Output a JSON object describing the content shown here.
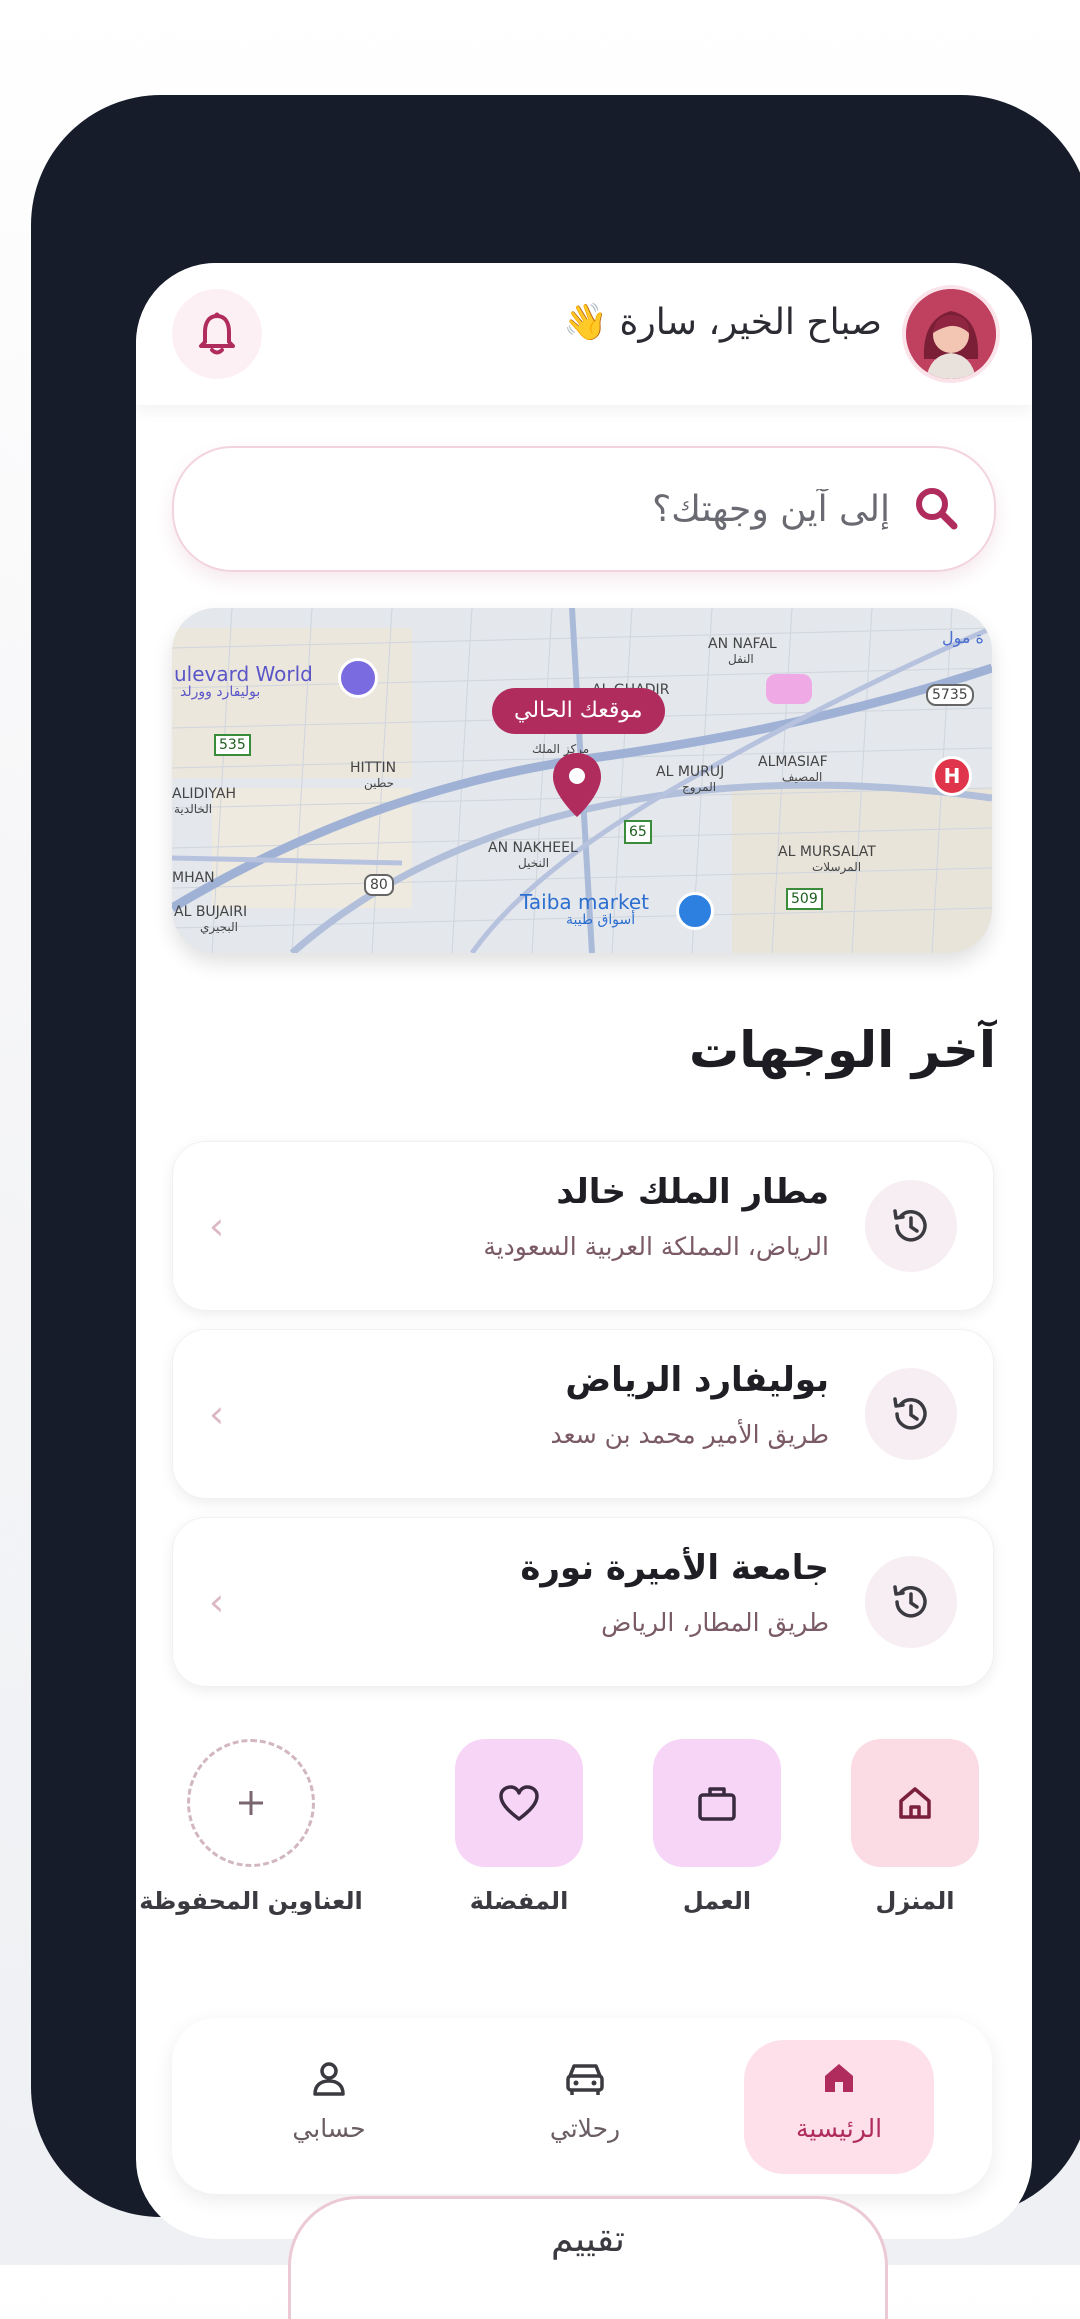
{
  "header": {
    "greeting": "صباح الخير، سارة 👋",
    "avatar": "avatar",
    "bell": "bell-icon"
  },
  "search": {
    "placeholder": "إلى آين وجهتك؟",
    "icon": "search-icon"
  },
  "map": {
    "current_location_label": "موقعك الحالي",
    "labels": {
      "boulevard": "ulevard World",
      "boulevard_ar": "بوليفارد وورلد",
      "an_nafal": "AN NAFAL",
      "an_nafal_ar": "النفل",
      "al_ghadir": "AL GHADIR",
      "hittin": "HITTIN",
      "hittin_ar": "حطين",
      "al_muruj": "AL MURUJ",
      "al_muruj_ar": "المروج",
      "al_masiaf": "ALMASIAF",
      "al_masiaf_ar": "المصيف",
      "alidiyah": "ALIDIYAH",
      "alidiyah_ar": "الخالدية",
      "an_nakheel": "AN NAKHEEL",
      "an_nakheel_ar": "النخيل",
      "al_mursalat": "AL MURSALAT",
      "al_mursalat_ar": "المرسلات",
      "mhan": "MHAN",
      "al_bujairi": "AL BUJAIRI",
      "al_bujairi_ar": "البجيري",
      "taiba_market": "Taiba market",
      "taiba_market_ar": "أسواق طيبة",
      "center_ar": "مركز الملك",
      "mall_ar": "ة مول",
      "road_535": "535",
      "road_5735": "5735",
      "road_65": "65",
      "road_80": "80",
      "road_509": "509",
      "hospital": "H"
    }
  },
  "recent": {
    "title": "آخر الوجهات",
    "items": [
      {
        "name": "مطار الملك خالد",
        "address": "الرياض، المملكة العربية السعودية"
      },
      {
        "name": "بوليفارد الرياض",
        "address": "طريق الأمير محمد بن سعد"
      },
      {
        "name": "جامعة الأميرة نورة",
        "address": "طريق المطار، الرياض"
      }
    ]
  },
  "quick_actions": [
    {
      "label": "المنزل",
      "icon": "home-icon"
    },
    {
      "label": "العمل",
      "icon": "briefcase-icon"
    },
    {
      "label": "المفضلة",
      "icon": "heart-icon"
    },
    {
      "label": "العناوين المحفوظة",
      "icon": "plus-icon"
    }
  ],
  "bottom_nav": [
    {
      "label": "الرئيسية",
      "icon": "home-icon",
      "active": true
    },
    {
      "label": "رحلاتي",
      "icon": "car-icon",
      "active": false
    },
    {
      "label": "حسابي",
      "icon": "user-icon",
      "active": false
    }
  ],
  "rate_label": "تقييم",
  "colors": {
    "brand": "#b02c5d",
    "frame": "#161c2a",
    "tile_pink": "#fbdbe4",
    "tile_lilac": "#f7d5f7"
  }
}
